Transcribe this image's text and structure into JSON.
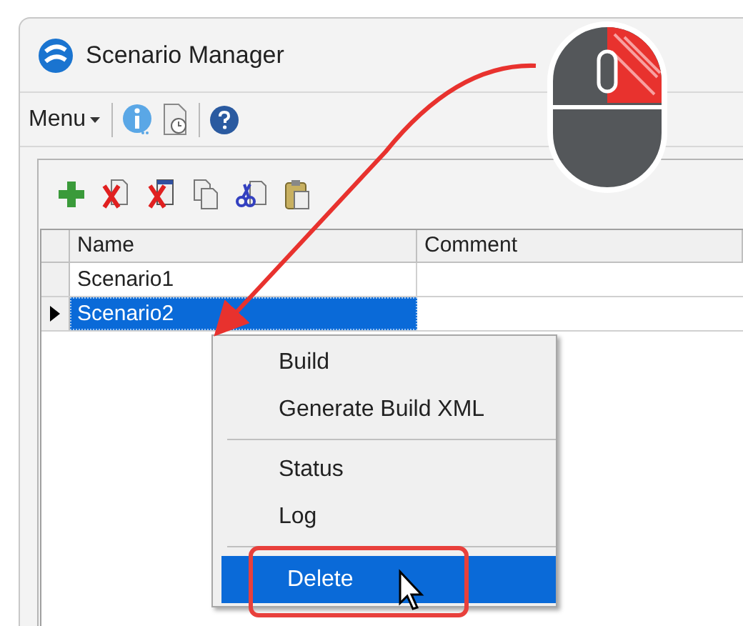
{
  "window": {
    "title": "Scenario Manager"
  },
  "menu_bar": {
    "menu_label": "Menu"
  },
  "grid": {
    "columns": [
      "Name",
      "Comment"
    ],
    "rows": [
      {
        "name": "Scenario1",
        "selected": false
      },
      {
        "name": "Scenario2",
        "selected": true
      }
    ]
  },
  "context_menu": {
    "items": [
      {
        "kind": "item",
        "label": "Build",
        "selected": false
      },
      {
        "kind": "item",
        "label": "Generate Build XML",
        "selected": false
      },
      {
        "kind": "separator"
      },
      {
        "kind": "item",
        "label": "Status",
        "selected": false
      },
      {
        "kind": "item",
        "label": "Log",
        "selected": false
      },
      {
        "kind": "separator"
      },
      {
        "kind": "item",
        "label": "Delete",
        "selected": true
      }
    ]
  }
}
